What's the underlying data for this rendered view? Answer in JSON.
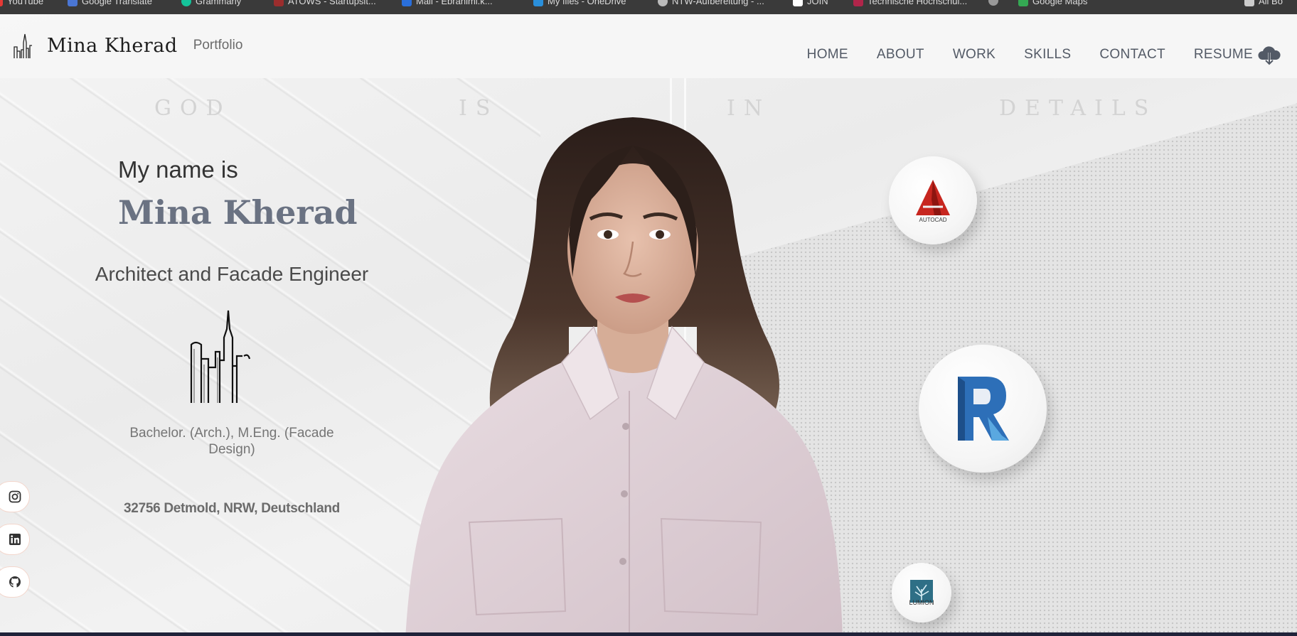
{
  "bookmarks": [
    {
      "label": "YouTube",
      "color": "#e53935"
    },
    {
      "label": "Google Translate",
      "color": "#4a76d4"
    },
    {
      "label": "Grammarly",
      "color": "#15c39a"
    },
    {
      "label": "ATOWS - Startupsit...",
      "color": "#9b2d2d"
    },
    {
      "label": "Mail - Ebrahimi.k...",
      "color": "#2a6fdb"
    },
    {
      "label": "My files - OneDrive",
      "color": "#2a8fdb"
    },
    {
      "label": "NTW-Aufbereitung - ...",
      "color": "#bbbbbb"
    },
    {
      "label": "JOIN",
      "color": "#ffffff"
    },
    {
      "label": "Technische Hochschul...",
      "color": "#b0254a"
    },
    {
      "label": "",
      "color": "#999999"
    },
    {
      "label": "Google Maps",
      "color": "#34a853"
    },
    {
      "label": "All Bo",
      "color": "#cccccc"
    }
  ],
  "header": {
    "brand_name": "Mina Kherad",
    "brand_sub": "Portfolio",
    "nav": [
      "HOME",
      "ABOUT",
      "WORK",
      "SKILLS",
      "CONTACT"
    ],
    "resume_label": "RESUME"
  },
  "motto": [
    "GOD",
    "IS",
    "IN",
    "DETAILS"
  ],
  "intro": {
    "greeting": "My name is",
    "name": "Mina Kherad",
    "role": "Architect and Facade Engineer",
    "degree": "Bachelor. (Arch.), M.Eng. (Facade Design)",
    "location": "32756 Detmold, NRW, Deutschland"
  },
  "social": [
    "instagram-icon",
    "linkedin-icon",
    "github-icon"
  ],
  "tools": [
    {
      "label": "AUTOCAD",
      "color": "#c7261f"
    },
    {
      "label": "",
      "color": "#2d6fb8"
    },
    {
      "label": "LUMION",
      "color": "#2e6f86"
    }
  ],
  "colors": {
    "accent_name": "#6a7282",
    "nav_text": "#535a66",
    "motto": "#d3d3d3"
  }
}
